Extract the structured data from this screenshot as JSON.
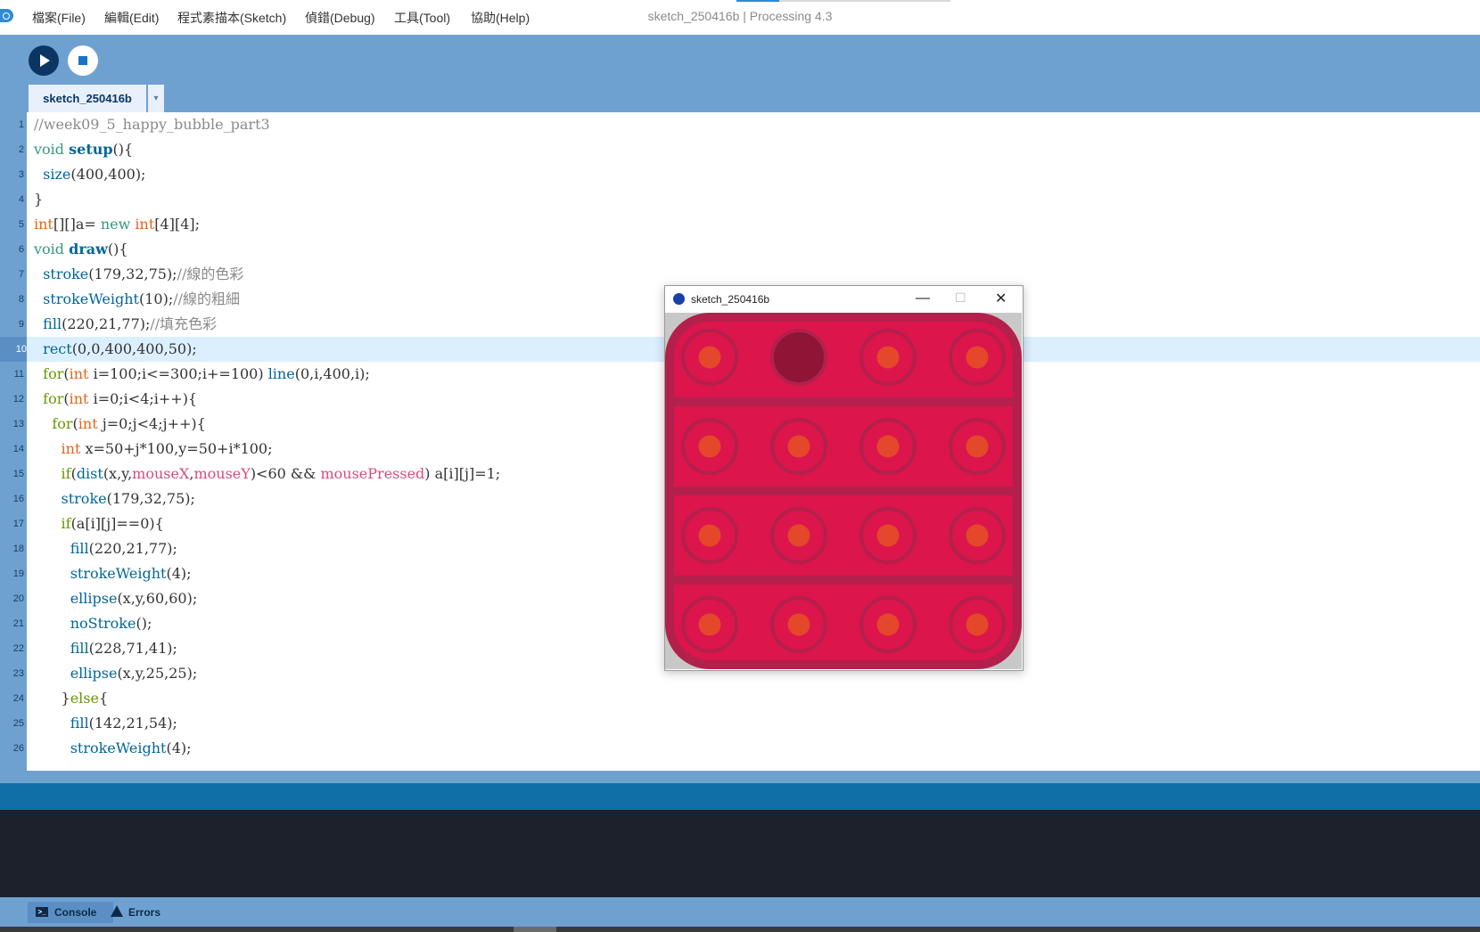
{
  "menu": {
    "items": [
      "檔案(File)",
      "編輯(Edit)",
      "程式素描本(Sketch)",
      "偵錯(Debug)",
      "工具(Tool)",
      "協助(Help)"
    ],
    "window_title": "sketch_250416b | Processing 4.3"
  },
  "toolbar": {
    "run_icon": "play-icon",
    "stop_icon": "stop-icon",
    "tab_label": "sketch_250416b",
    "tab_menu_glyph": "▾"
  },
  "editor": {
    "highlighted_line": 10,
    "line_numbers": [
      "1",
      "2",
      "3",
      "4",
      "5",
      "6",
      "7",
      "8",
      "9",
      "10",
      "11",
      "12",
      "13",
      "14",
      "15",
      "16",
      "17",
      "18",
      "19",
      "20",
      "21",
      "22",
      "23",
      "24",
      "25",
      "26"
    ],
    "lines": [
      [
        {
          "t": "//week09_5_happy_bubble_part3",
          "c": "cm"
        }
      ],
      [
        {
          "t": "void",
          "c": "kw"
        },
        {
          "t": " "
        },
        {
          "t": "setup",
          "c": "fd"
        },
        {
          "t": "(){"
        }
      ],
      [
        {
          "t": "  "
        },
        {
          "t": "size",
          "c": "fn"
        },
        {
          "t": "(400,400);"
        }
      ],
      [
        {
          "t": "}"
        }
      ],
      [
        {
          "t": "int",
          "c": "kt"
        },
        {
          "t": "[][]a= "
        },
        {
          "t": "new",
          "c": "kb"
        },
        {
          "t": " "
        },
        {
          "t": "int",
          "c": "kt"
        },
        {
          "t": "[4][4];"
        }
      ],
      [
        {
          "t": "void",
          "c": "kw"
        },
        {
          "t": " "
        },
        {
          "t": "draw",
          "c": "fd"
        },
        {
          "t": "(){"
        }
      ],
      [
        {
          "t": "  "
        },
        {
          "t": "stroke",
          "c": "fn"
        },
        {
          "t": "(179,32,75);"
        },
        {
          "t": "//線的色彩",
          "c": "cm"
        }
      ],
      [
        {
          "t": "  "
        },
        {
          "t": "strokeWeight",
          "c": "fn"
        },
        {
          "t": "(10);"
        },
        {
          "t": "//線的粗細",
          "c": "cm"
        }
      ],
      [
        {
          "t": "  "
        },
        {
          "t": "fill",
          "c": "fn"
        },
        {
          "t": "(220,21,77);"
        },
        {
          "t": "//填充色彩",
          "c": "cm"
        }
      ],
      [
        {
          "t": "  "
        },
        {
          "t": "rect",
          "c": "fn"
        },
        {
          "t": "(0,0,400,400,50);"
        }
      ],
      [
        {
          "t": "  "
        },
        {
          "t": "for",
          "c": "ctl"
        },
        {
          "t": "("
        },
        {
          "t": "int",
          "c": "kt"
        },
        {
          "t": " i=100;i<=300;i+=100) "
        },
        {
          "t": "line",
          "c": "fn"
        },
        {
          "t": "(0,i,400,i);"
        }
      ],
      [
        {
          "t": "  "
        },
        {
          "t": "for",
          "c": "ctl"
        },
        {
          "t": "("
        },
        {
          "t": "int",
          "c": "kt"
        },
        {
          "t": " i=0;i<4;i++){"
        }
      ],
      [
        {
          "t": "    "
        },
        {
          "t": "for",
          "c": "ctl"
        },
        {
          "t": "("
        },
        {
          "t": "int",
          "c": "kt"
        },
        {
          "t": " j=0;j<4;j++){"
        }
      ],
      [
        {
          "t": "      "
        },
        {
          "t": "int",
          "c": "kt"
        },
        {
          "t": " x=50+j*100,y=50+i*100;"
        }
      ],
      [
        {
          "t": "      "
        },
        {
          "t": "if",
          "c": "ctl"
        },
        {
          "t": "("
        },
        {
          "t": "dist",
          "c": "fn"
        },
        {
          "t": "(x,y,"
        },
        {
          "t": "mouseX",
          "c": "va"
        },
        {
          "t": ","
        },
        {
          "t": "mouseY",
          "c": "va"
        },
        {
          "t": ")<60 && "
        },
        {
          "t": "mousePressed",
          "c": "va"
        },
        {
          "t": ") a[i][j]=1;"
        }
      ],
      [
        {
          "t": "      "
        },
        {
          "t": "stroke",
          "c": "fn"
        },
        {
          "t": "(179,32,75);"
        }
      ],
      [
        {
          "t": "      "
        },
        {
          "t": "if",
          "c": "ctl"
        },
        {
          "t": "(a[i][j]==0){"
        }
      ],
      [
        {
          "t": "        "
        },
        {
          "t": "fill",
          "c": "fn"
        },
        {
          "t": "(220,21,77);"
        }
      ],
      [
        {
          "t": "        "
        },
        {
          "t": "strokeWeight",
          "c": "fn"
        },
        {
          "t": "(4);"
        }
      ],
      [
        {
          "t": "        "
        },
        {
          "t": "ellipse",
          "c": "fn"
        },
        {
          "t": "(x,y,60,60);"
        }
      ],
      [
        {
          "t": "        "
        },
        {
          "t": "noStroke",
          "c": "fn"
        },
        {
          "t": "();"
        }
      ],
      [
        {
          "t": "        "
        },
        {
          "t": "fill",
          "c": "fn"
        },
        {
          "t": "(228,71,41);"
        }
      ],
      [
        {
          "t": "        "
        },
        {
          "t": "ellipse",
          "c": "fn"
        },
        {
          "t": "(x,y,25,25);"
        }
      ],
      [
        {
          "t": "      }"
        },
        {
          "t": "else",
          "c": "ctl"
        },
        {
          "t": "{"
        }
      ],
      [
        {
          "t": "        "
        },
        {
          "t": "fill",
          "c": "fn"
        },
        {
          "t": "(142,21,54);"
        }
      ],
      [
        {
          "t": "        "
        },
        {
          "t": "strokeWeight",
          "c": "fn"
        },
        {
          "t": "(4);"
        }
      ]
    ]
  },
  "footer": {
    "console_label": "Console",
    "errors_label": "Errors",
    "console_icon": "terminal-icon",
    "errors_icon": "warning-icon"
  },
  "sketch_window": {
    "title": "sketch_250416b",
    "minimize_glyph": "—",
    "maximize_glyph": "☐",
    "close_glyph": "✕",
    "pressed": [
      [
        0,
        1,
        0,
        0
      ],
      [
        0,
        0,
        0,
        0
      ],
      [
        0,
        0,
        0,
        0
      ],
      [
        0,
        0,
        0,
        0
      ]
    ],
    "colors": {
      "background": "#dc154d",
      "stroke": "#b3204b",
      "inner": "#e44729",
      "pressed_fill": "#8e1536"
    }
  }
}
